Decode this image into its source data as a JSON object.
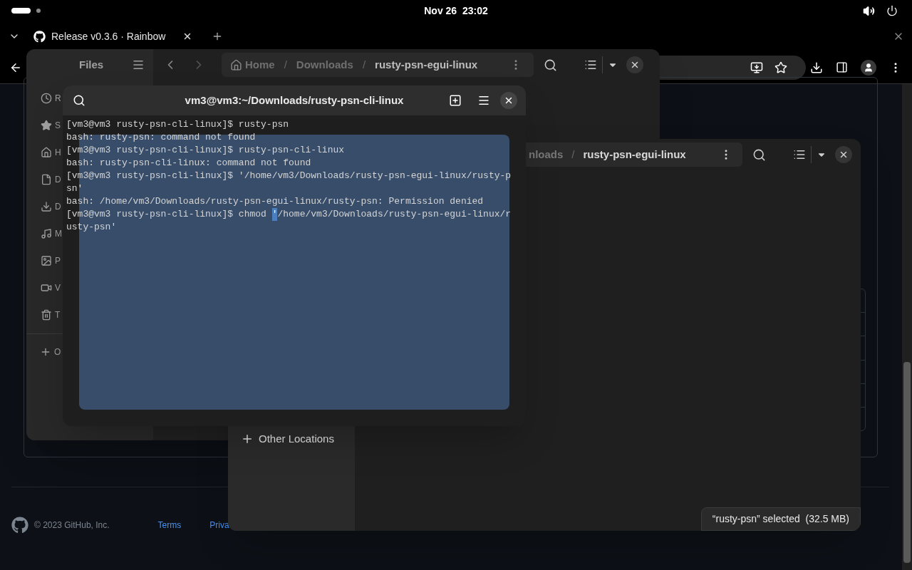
{
  "top_bar": {
    "clock": "Nov 26  23:02"
  },
  "browser": {
    "tab_title": "Release v0.3.6 · Rainbow",
    "footer": {
      "copyright": "© 2023 GitHub, Inc.",
      "links": [
        "Terms",
        "Priva"
      ]
    }
  },
  "files_back": {
    "title": "Files",
    "breadcrumb": [
      {
        "kind": "home",
        "label": "Home"
      },
      {
        "kind": "separator",
        "label": "/"
      },
      {
        "kind": "folder",
        "label": "Downloads"
      },
      {
        "kind": "separator",
        "label": "/"
      },
      {
        "kind": "current",
        "label": "rusty-psn-egui-linux"
      }
    ],
    "sidebar": [
      {
        "kind": "recent",
        "label": "R"
      },
      {
        "kind": "starred",
        "label": "S"
      },
      {
        "kind": "home",
        "label": "H"
      },
      {
        "kind": "documents",
        "label": "D"
      },
      {
        "kind": "downloads",
        "label": "D"
      },
      {
        "kind": "music",
        "label": "M"
      },
      {
        "kind": "pictures",
        "label": "P"
      },
      {
        "kind": "videos",
        "label": "V"
      },
      {
        "kind": "trash",
        "label": "T"
      },
      {
        "kind": "other",
        "label": "O"
      }
    ]
  },
  "files_front": {
    "breadcrumb": [
      {
        "kind": "folder",
        "label": "nloads"
      },
      {
        "kind": "separator",
        "label": "/"
      },
      {
        "kind": "current",
        "label": "rusty-psn-egui-linux"
      }
    ],
    "sidebar": [
      {
        "kind": "other",
        "label": "Other Locations"
      }
    ],
    "status": "“rusty-psn” selected  (32.5 MB)"
  },
  "terminal": {
    "title": "vm3@vm3:~/Downloads/rusty-psn-cli-linux",
    "lines": [
      {
        "kind": "text",
        "text": "[vm3@vm3 rusty-psn-cli-linux]$ rusty-psn"
      },
      {
        "kind": "text",
        "text": "bash: rusty-psn: command not found"
      },
      {
        "kind": "text",
        "text": "[vm3@vm3 rusty-psn-cli-linux]$ rusty-psn-cli-linux"
      },
      {
        "kind": "text",
        "text": "bash: rusty-psn-cli-linux: command not found"
      },
      {
        "kind": "text",
        "text": "[vm3@vm3 rusty-psn-cli-linux]$ '/home/vm3/Downloads/rusty-psn-egui-linux/rusty-p"
      },
      {
        "kind": "text",
        "text": "sn'"
      },
      {
        "kind": "text",
        "text": "bash: /home/vm3/Downloads/rusty-psn-egui-linux/rusty-psn: Permission denied"
      },
      {
        "kind": "cursor",
        "before": "[vm3@vm3 rusty-psn-cli-linux]$ chmod ",
        "cursor": "'",
        "after": "/home/vm3/Downloads/rusty-psn-egui-linux/r"
      },
      {
        "kind": "text",
        "text": "usty-psn'"
      }
    ]
  }
}
